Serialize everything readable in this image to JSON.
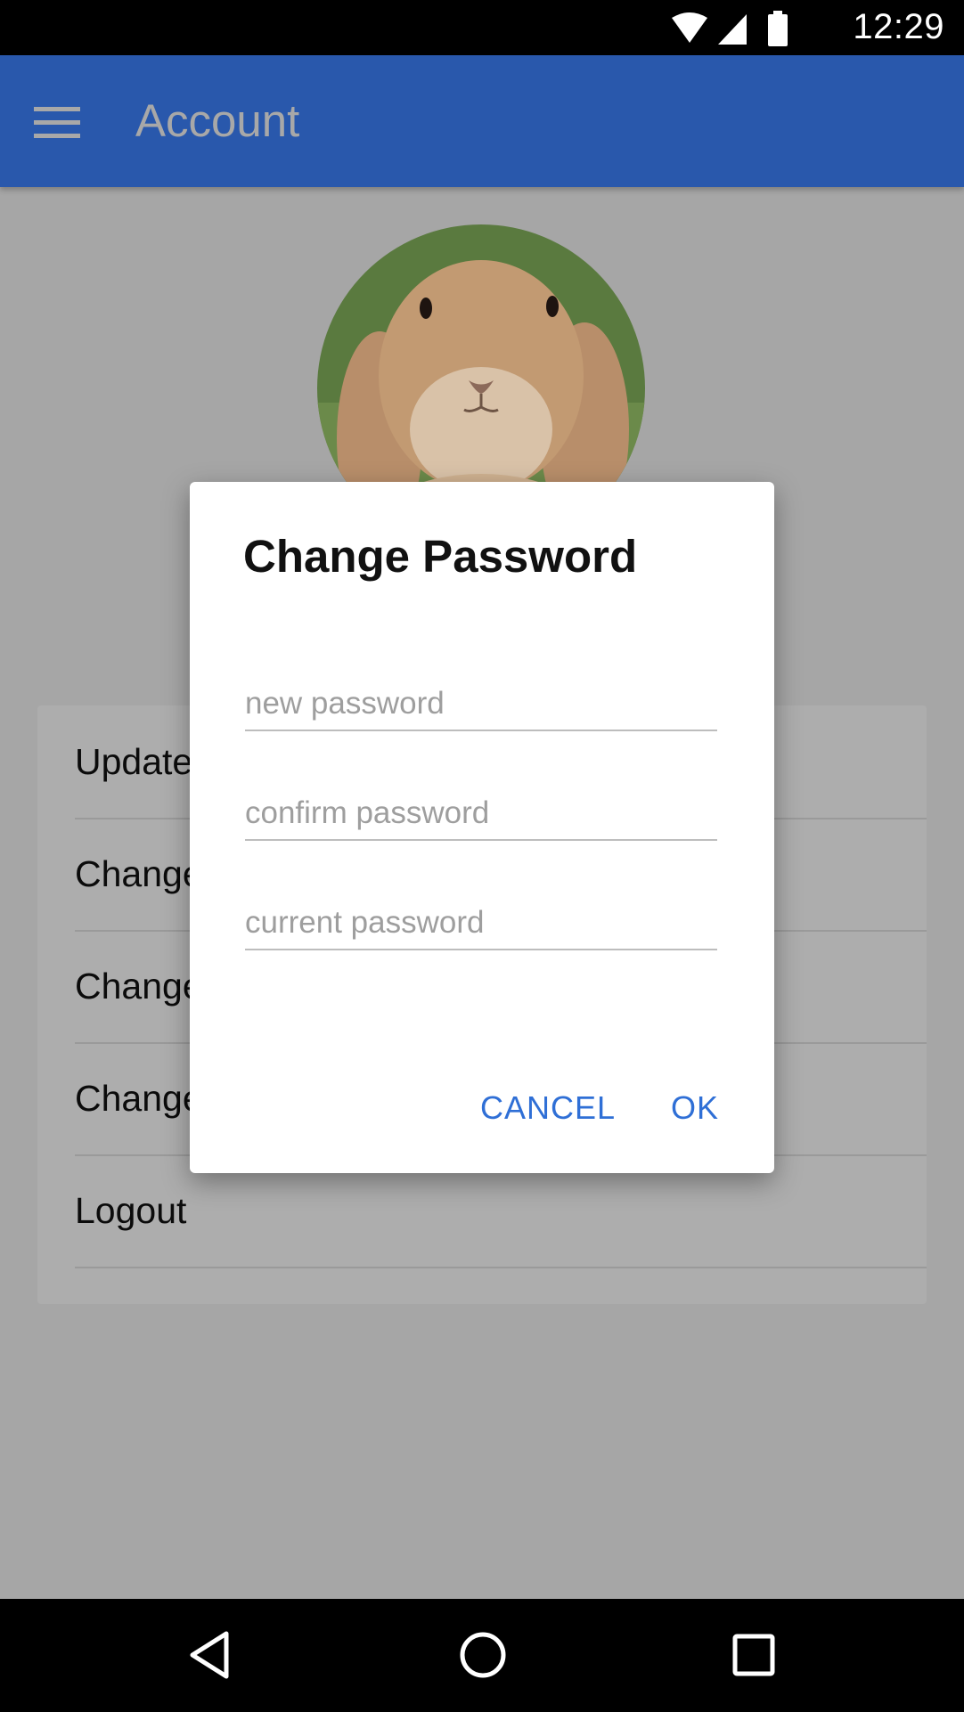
{
  "status_bar": {
    "time": "12:29",
    "icons": [
      "wifi-icon",
      "cell-signal-icon",
      "battery-icon"
    ]
  },
  "app_bar": {
    "title": "Account",
    "menu_icon": "hamburger-menu-icon",
    "color": "#2958ac"
  },
  "menu": {
    "items": [
      {
        "label": "Update"
      },
      {
        "label": "Change"
      },
      {
        "label": "Change"
      },
      {
        "label": "Change"
      },
      {
        "label": "Logout"
      }
    ]
  },
  "dialog": {
    "title": "Change Password",
    "fields": [
      {
        "placeholder": "new password",
        "value": ""
      },
      {
        "placeholder": "confirm password",
        "value": ""
      },
      {
        "placeholder": "current password",
        "value": ""
      }
    ],
    "cancel_label": "CANCEL",
    "ok_label": "OK",
    "accent_color": "#2f6fd6"
  },
  "nav_bar": {
    "icons": [
      "back-icon",
      "home-icon",
      "recents-icon"
    ]
  }
}
